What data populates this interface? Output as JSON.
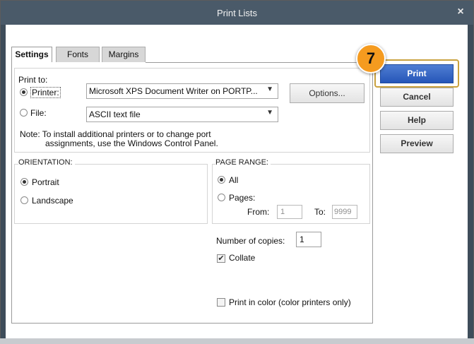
{
  "window": {
    "title": "Print Lists",
    "close_symbol": "×"
  },
  "tabs": [
    {
      "label": "Settings",
      "active": true
    },
    {
      "label": "Fonts",
      "active": false
    },
    {
      "label": "Margins",
      "active": false
    }
  ],
  "print_to": {
    "label": "Print to:",
    "printer_label": "Printer:",
    "printer_value": "Microsoft XPS Document Writer on PORTP...",
    "file_label": "File:",
    "file_value": "ASCII text file",
    "selected": "printer",
    "options_button": "Options...",
    "note_line1": "Note: To install additional printers or to change port",
    "note_line2": "assignments, use the Windows Control Panel."
  },
  "orientation": {
    "label": "ORIENTATION:",
    "portrait": "Portrait",
    "landscape": "Landscape",
    "selected": "portrait"
  },
  "page_range": {
    "label": "PAGE RANGE:",
    "all": "All",
    "pages": "Pages:",
    "from_label": "From:",
    "from_value": "1",
    "to_label": "To:",
    "to_value": "9999",
    "selected": "all"
  },
  "copies": {
    "label": "Number of copies:",
    "value": "1"
  },
  "collate": {
    "label": "Collate",
    "checked": true
  },
  "print_in_color": {
    "label": "Print in color (color printers only)",
    "checked": false
  },
  "buttons": {
    "print": "Print",
    "cancel": "Cancel",
    "help": "Help",
    "preview": "Preview"
  },
  "callout": {
    "step": "7"
  },
  "colors": {
    "accent_blue": "#2f62c4",
    "callout_orange": "#f59b1f",
    "highlight_gold": "#c9a13d"
  }
}
